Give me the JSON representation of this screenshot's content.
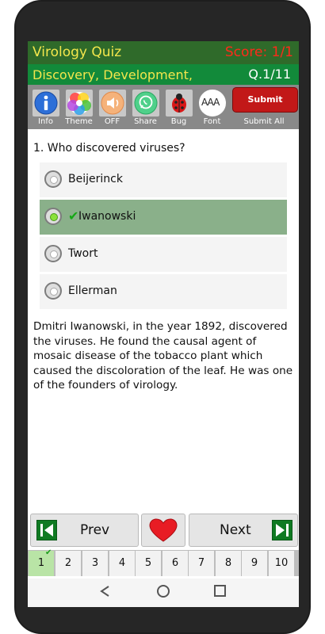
{
  "header": {
    "app_title": "Virology Quiz",
    "score": "Score: 1/1",
    "topic": "Discovery, Development,",
    "question_number": "Q.1/11"
  },
  "toolbar": {
    "info": "Info",
    "theme": "Theme",
    "sound": "OFF",
    "share": "Share",
    "bug": "Bug",
    "font": "Font",
    "font_icon_text": "AAA",
    "submit": "Submit",
    "submit_all": "Submit All"
  },
  "question": {
    "text": "1. Who discovered viruses?",
    "options": [
      {
        "label": "Beijerinck",
        "selected": false
      },
      {
        "label": "Iwanowski",
        "selected": true
      },
      {
        "label": "Twort",
        "selected": false
      },
      {
        "label": "Ellerman",
        "selected": false
      }
    ],
    "explanation": "Dmitri Iwanowski, in the year 1892, discovered the viruses. He found the causal agent of mosaic disease of the tobacco plant which caused the discoloration of the leaf. He was one of the founders of virology."
  },
  "nav": {
    "prev": "Prev",
    "next": "Next"
  },
  "pager": {
    "pages": [
      "1",
      "2",
      "3",
      "4",
      "5",
      "6",
      "7",
      "8",
      "9",
      "10"
    ],
    "current": "1"
  },
  "colors": {
    "title_bar": "#2f6a2a",
    "topic_bar": "#128a3a",
    "selected_option": "#8ab08a",
    "score": "#ff2a1a",
    "title_text": "#f3e64c"
  }
}
